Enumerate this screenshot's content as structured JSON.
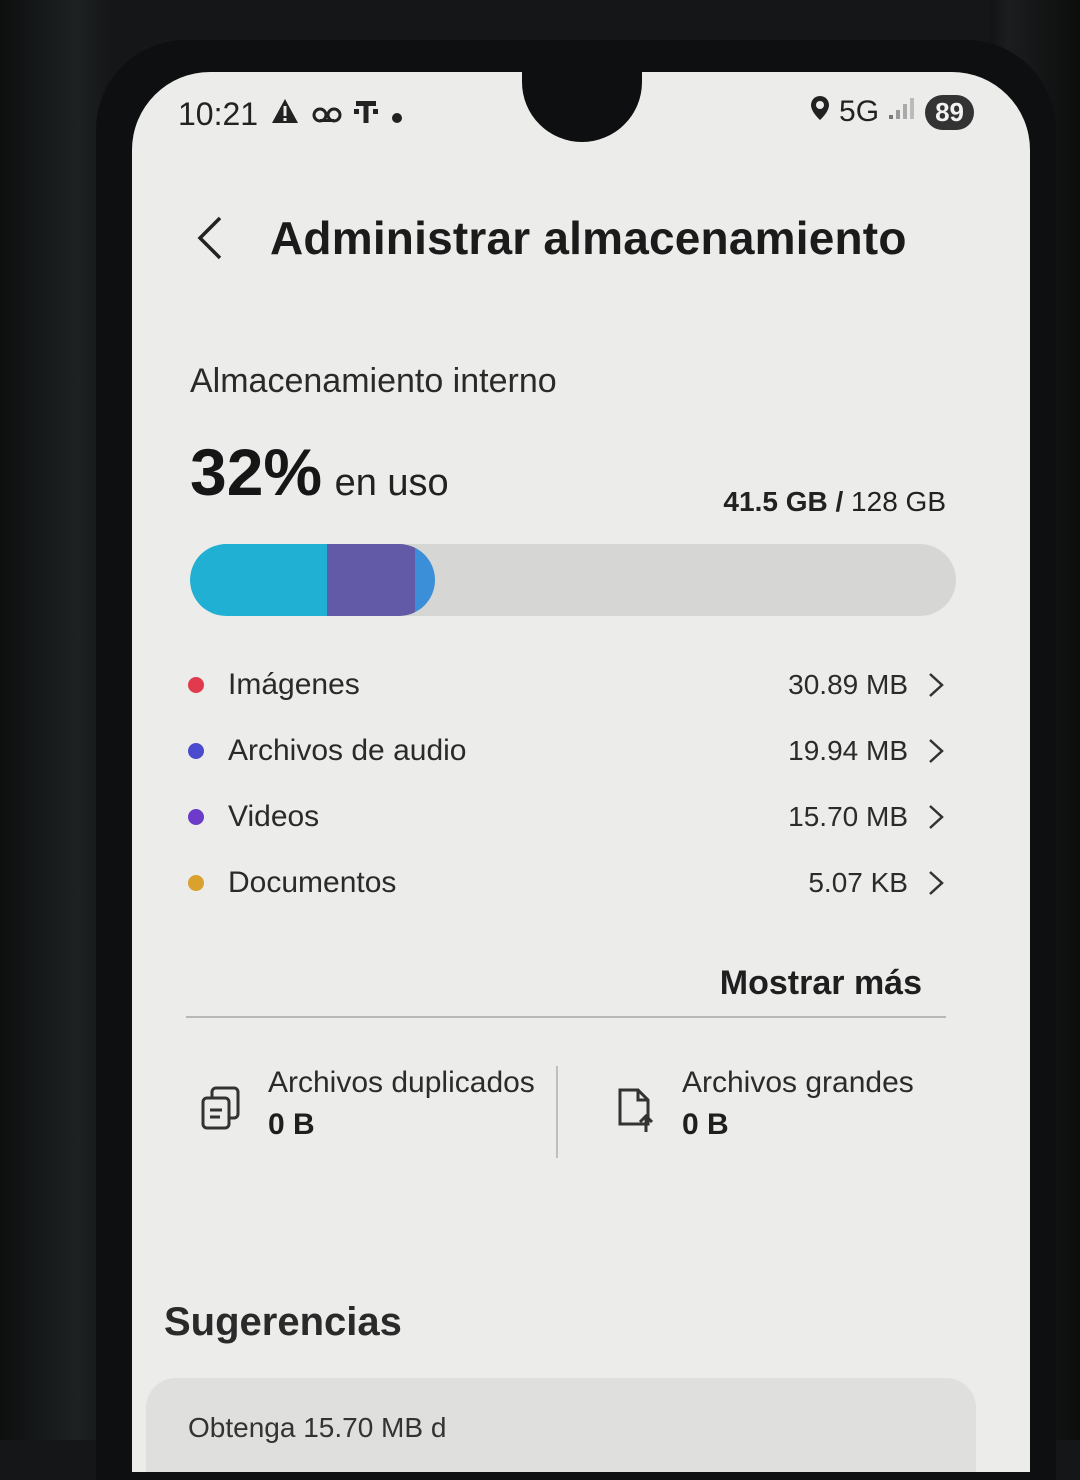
{
  "status_bar": {
    "time": "10:21",
    "network": "5G",
    "battery": "89"
  },
  "header": {
    "title": "Administrar almacenamiento"
  },
  "storage": {
    "section_label": "Almacenamiento interno",
    "percent": "32%",
    "percent_suffix": "en uso",
    "used": "41.5 GB",
    "separator": " / ",
    "total": "128 GB",
    "usage_fraction": 0.32,
    "bar_segments": [
      {
        "color": "#1fb0d4",
        "fraction": 0.56
      },
      {
        "color": "#625aa6",
        "fraction": 0.36
      },
      {
        "color": "#3a8fd8",
        "fraction": 0.08
      }
    ]
  },
  "categories": [
    {
      "label": "Imágenes",
      "value": "30.89 MB",
      "color": "#e03a4c"
    },
    {
      "label": "Archivos de audio",
      "value": "19.94 MB",
      "color": "#4b4bd0"
    },
    {
      "label": "Videos",
      "value": "15.70 MB",
      "color": "#6c3bc9"
    },
    {
      "label": "Documentos",
      "value": "5.07 KB",
      "color": "#d9a22e"
    }
  ],
  "show_more": "Mostrar más",
  "tiles": {
    "duplicates": {
      "title": "Archivos duplicados",
      "value": "0 B",
      "icon": "copy-files-icon"
    },
    "large": {
      "title": "Archivos grandes",
      "value": "0 B",
      "icon": "large-file-upload-icon"
    }
  },
  "suggestions": {
    "heading": "Sugerencias",
    "card_text": "Obtenga 15.70 MB d"
  }
}
